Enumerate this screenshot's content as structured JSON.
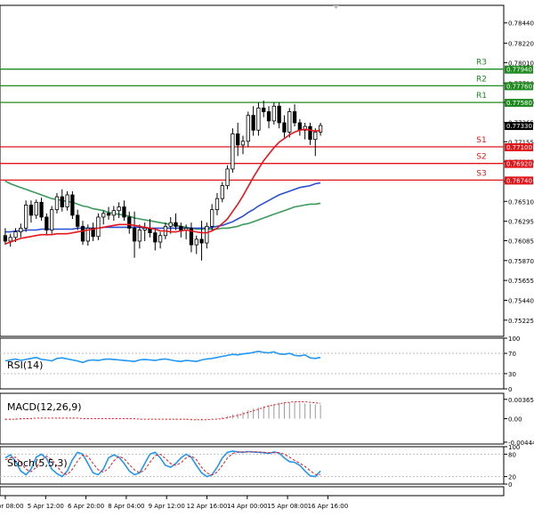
{
  "chart_data": {
    "type": "candlestick",
    "price": {
      "ylim": [
        0.7505,
        0.7863
      ],
      "yticks": [
        "0.78440",
        "0.78220",
        "0.78010",
        "0.77790",
        "0.77580",
        "0.77365",
        "0.77155",
        "0.76940",
        "0.76725",
        "0.76510",
        "0.76295",
        "0.76085",
        "0.75870",
        "0.75655",
        "0.75440",
        "0.75225"
      ],
      "current_price": "0.77330",
      "levels": [
        {
          "name": "R3",
          "value": 0.7794,
          "label": "0.77940",
          "color": "#1f8a1f"
        },
        {
          "name": "R2",
          "value": 0.7776,
          "label": "0.77760",
          "color": "#1f8a1f"
        },
        {
          "name": "R1",
          "value": 0.7758,
          "label": "0.77580",
          "color": "#1f8a1f"
        },
        {
          "name": "S1",
          "value": 0.771,
          "label": "0.77100",
          "color": "#e0161a"
        },
        {
          "name": "S2",
          "value": 0.7692,
          "label": "0.76920",
          "color": "#e0161a"
        },
        {
          "name": "S3",
          "value": 0.7674,
          "label": "0.76740",
          "color": "#e0161a"
        }
      ],
      "candles": [
        [
          0.7614,
          0.7622,
          0.7604,
          0.7608
        ],
        [
          0.7608,
          0.7616,
          0.7602,
          0.7612
        ],
        [
          0.7612,
          0.7622,
          0.7607,
          0.7618
        ],
        [
          0.7618,
          0.7627,
          0.7612,
          0.7622
        ],
        [
          0.7622,
          0.7652,
          0.7618,
          0.7647
        ],
        [
          0.7647,
          0.7652,
          0.7628,
          0.7636
        ],
        [
          0.7636,
          0.7653,
          0.7632,
          0.765
        ],
        [
          0.765,
          0.7655,
          0.763,
          0.7634
        ],
        [
          0.7634,
          0.7638,
          0.7614,
          0.762
        ],
        [
          0.762,
          0.7646,
          0.7616,
          0.7642
        ],
        [
          0.7642,
          0.766,
          0.7638,
          0.7656
        ],
        [
          0.7656,
          0.7664,
          0.764,
          0.7645
        ],
        [
          0.7645,
          0.7662,
          0.7641,
          0.7658
        ],
        [
          0.7658,
          0.7662,
          0.7632,
          0.7636
        ],
        [
          0.7636,
          0.7642,
          0.762,
          0.7624
        ],
        [
          0.7624,
          0.763,
          0.7604,
          0.7608
        ],
        [
          0.7608,
          0.7626,
          0.7603,
          0.7622
        ],
        [
          0.7622,
          0.7628,
          0.7608,
          0.7613
        ],
        [
          0.7613,
          0.7638,
          0.7609,
          0.7634
        ],
        [
          0.7634,
          0.7641,
          0.7626,
          0.7638
        ],
        [
          0.7638,
          0.7645,
          0.7631,
          0.7636
        ],
        [
          0.7636,
          0.7646,
          0.763,
          0.7641
        ],
        [
          0.7641,
          0.765,
          0.7633,
          0.7645
        ],
        [
          0.7645,
          0.7652,
          0.763,
          0.7634
        ],
        [
          0.7634,
          0.764,
          0.7616,
          0.7622
        ],
        [
          0.7622,
          0.764,
          0.759,
          0.7608
        ],
        [
          0.7608,
          0.7626,
          0.76,
          0.762
        ],
        [
          0.762,
          0.7628,
          0.7608,
          0.7622
        ],
        [
          0.7622,
          0.7632,
          0.7612,
          0.7617
        ],
        [
          0.7617,
          0.7622,
          0.7598,
          0.7607
        ],
        [
          0.7607,
          0.7618,
          0.76,
          0.7614
        ],
        [
          0.7614,
          0.7628,
          0.761,
          0.7624
        ],
        [
          0.7624,
          0.7634,
          0.7616,
          0.7628
        ],
        [
          0.7628,
          0.7638,
          0.762,
          0.7624
        ],
        [
          0.7624,
          0.7628,
          0.7612,
          0.762
        ],
        [
          0.762,
          0.7626,
          0.761,
          0.7622
        ],
        [
          0.7622,
          0.7628,
          0.7596,
          0.7604
        ],
        [
          0.7604,
          0.7614,
          0.7594,
          0.761
        ],
        [
          0.761,
          0.763,
          0.7587,
          0.7606
        ],
        [
          0.7606,
          0.7628,
          0.76,
          0.7624
        ],
        [
          0.7624,
          0.7648,
          0.762,
          0.7642
        ],
        [
          0.7642,
          0.766,
          0.7636,
          0.7654
        ],
        [
          0.7654,
          0.7672,
          0.765,
          0.7668
        ],
        [
          0.7668,
          0.769,
          0.7664,
          0.7686
        ],
        [
          0.7686,
          0.773,
          0.7682,
          0.7724
        ],
        [
          0.7724,
          0.7736,
          0.77,
          0.7712
        ],
        [
          0.7712,
          0.7722,
          0.7702,
          0.7716
        ],
        [
          0.7716,
          0.7748,
          0.771,
          0.7744
        ],
        [
          0.7744,
          0.7754,
          0.7722,
          0.7728
        ],
        [
          0.7728,
          0.7758,
          0.7722,
          0.7752
        ],
        [
          0.7752,
          0.776,
          0.7742,
          0.7748
        ],
        [
          0.7748,
          0.7754,
          0.773,
          0.7738
        ],
        [
          0.7738,
          0.7758,
          0.7734,
          0.7754
        ],
        [
          0.7754,
          0.7758,
          0.773,
          0.7736
        ],
        [
          0.7736,
          0.7744,
          0.772,
          0.7726
        ],
        [
          0.7726,
          0.7752,
          0.772,
          0.7748
        ],
        [
          0.7748,
          0.7756,
          0.7732,
          0.7736
        ],
        [
          0.7736,
          0.774,
          0.7722,
          0.7728
        ],
        [
          0.7728,
          0.7736,
          0.7718,
          0.7732
        ],
        [
          0.7732,
          0.7736,
          0.7712,
          0.7718
        ],
        [
          0.7718,
          0.773,
          0.77,
          0.7726
        ],
        [
          0.7726,
          0.7736,
          0.7722,
          0.7733
        ]
      ],
      "ma_fast": {
        "color": "#e8151b",
        "values": [
          0.7605,
          0.7607,
          0.7609,
          0.7611,
          0.7612,
          0.7613,
          0.7614,
          0.7615,
          0.7615,
          0.7615,
          0.7616,
          0.7616,
          0.7616,
          0.7617,
          0.7618,
          0.7619,
          0.762,
          0.7621,
          0.7622,
          0.7623,
          0.7624,
          0.7625,
          0.7626,
          0.7626,
          0.7626,
          0.7625,
          0.7624,
          0.7623,
          0.7622,
          0.7621,
          0.7619,
          0.7619,
          0.7618,
          0.7618,
          0.7619,
          0.762,
          0.7619,
          0.7618,
          0.7617,
          0.7617,
          0.7619,
          0.7622,
          0.7627,
          0.7632,
          0.764,
          0.7648,
          0.7657,
          0.7667,
          0.7677,
          0.7686,
          0.7695,
          0.7702,
          0.7709,
          0.7715,
          0.7719,
          0.7723,
          0.7726,
          0.7728,
          0.7729,
          0.7728,
          0.7727,
          0.7728
        ]
      },
      "ma_mid": {
        "color": "#2a4fd6",
        "values": [
          0.7618,
          0.7618,
          0.7619,
          0.7619,
          0.762,
          0.762,
          0.762,
          0.7621,
          0.7621,
          0.7621,
          0.7621,
          0.7621,
          0.7621,
          0.7621,
          0.7622,
          0.7622,
          0.7622,
          0.7622,
          0.7622,
          0.7623,
          0.7623,
          0.7623,
          0.7623,
          0.7623,
          0.7623,
          0.7623,
          0.7623,
          0.7622,
          0.7622,
          0.7622,
          0.7622,
          0.7622,
          0.7622,
          0.7622,
          0.7622,
          0.7622,
          0.7622,
          0.7622,
          0.7622,
          0.7622,
          0.7623,
          0.7624,
          0.7625,
          0.7627,
          0.7629,
          0.7632,
          0.7635,
          0.7639,
          0.7642,
          0.7646,
          0.7649,
          0.7652,
          0.7655,
          0.7658,
          0.766,
          0.7662,
          0.7664,
          0.7666,
          0.7667,
          0.7668,
          0.767,
          0.7671
        ]
      },
      "ma_slow": {
        "color": "#3a9a5a",
        "values": [
          0.7673,
          0.767,
          0.7668,
          0.7666,
          0.7664,
          0.7662,
          0.766,
          0.7658,
          0.7656,
          0.7654,
          0.7653,
          0.7652,
          0.7651,
          0.765,
          0.7648,
          0.7646,
          0.7645,
          0.7643,
          0.7642,
          0.7641,
          0.7639,
          0.7638,
          0.7637,
          0.7636,
          0.7635,
          0.7633,
          0.7632,
          0.7631,
          0.763,
          0.7629,
          0.7628,
          0.7627,
          0.7626,
          0.7625,
          0.7624,
          0.7623,
          0.7622,
          0.7621,
          0.7621,
          0.7621,
          0.7621,
          0.7621,
          0.7622,
          0.7622,
          0.7623,
          0.7624,
          0.7626,
          0.7627,
          0.7629,
          0.7631,
          0.7633,
          0.7635,
          0.7637,
          0.7639,
          0.7641,
          0.7643,
          0.7645,
          0.7646,
          0.7647,
          0.7648,
          0.7648,
          0.7649
        ]
      }
    },
    "x_tick_labels": [
      "2 Apr 08:00",
      "5 Apr 12:00",
      "6 Apr 20:00",
      "8 Apr 04:00",
      "9 Apr 12:00",
      "12 Apr 16:00",
      "14 Apr 00:00",
      "15 Apr 08:00",
      "16 Apr 16:00"
    ],
    "rsi": {
      "label": "RSI(14)",
      "ylim": [
        0,
        100
      ],
      "yticks": [
        "100",
        "70",
        "30",
        "0"
      ],
      "color": "#2196f3",
      "values": [
        55,
        57,
        59,
        56,
        58,
        60,
        62,
        58,
        57,
        55,
        60,
        61,
        59,
        57,
        55,
        52,
        56,
        57,
        56,
        58,
        59,
        58,
        57,
        56,
        55,
        54,
        57,
        58,
        57,
        56,
        58,
        59,
        57,
        55,
        54,
        56,
        55,
        54,
        57,
        59,
        60,
        62,
        64,
        66,
        68,
        67,
        69,
        70,
        72,
        74,
        72,
        71,
        73,
        69,
        68,
        70,
        66,
        65,
        67,
        61,
        60,
        62
      ]
    },
    "macd": {
      "label": "MACD(12,26,9)",
      "yticks": [
        "0.003659",
        "0.00",
        "-0.004448"
      ],
      "ylim": [
        -0.0048,
        0.0048
      ],
      "histogram": [
        -0.0003,
        -0.0003,
        -0.0002,
        -0.0002,
        -0.0001,
        -0.0001,
        0.0,
        0.0,
        0.0,
        0.0001,
        0.0001,
        0.0001,
        0.0001,
        0.0001,
        0.0,
        0.0,
        0.0,
        0.0,
        0.0,
        0.0,
        0.0,
        0.0,
        0.0,
        0.0,
        0.0,
        -0.0001,
        -0.0001,
        -0.0001,
        -0.0001,
        -0.0001,
        -0.0001,
        -0.0001,
        -0.0002,
        -0.0002,
        -0.0002,
        -0.0002,
        -0.0002,
        -0.0002,
        -0.0002,
        -0.0001,
        0.0,
        0.0001,
        0.0003,
        0.0005,
        0.0008,
        0.001,
        0.0013,
        0.0016,
        0.0019,
        0.0021,
        0.0024,
        0.0026,
        0.0028,
        0.003,
        0.0031,
        0.0031,
        0.0031,
        0.003,
        0.0029,
        0.0028,
        0.0027,
        0.0026
      ],
      "signal": [
        -0.0001,
        -0.0001,
        -0.0001,
        0.0,
        0.0,
        0.0,
        0.0001,
        0.0001,
        0.0001,
        0.0001,
        0.0001,
        0.0001,
        0.0001,
        0.0001,
        0.0001,
        0.0,
        0.0,
        0.0,
        0.0,
        0.0,
        0.0,
        0.0,
        0.0,
        0.0,
        0.0,
        0.0,
        -0.0001,
        -0.0001,
        -0.0001,
        -0.0001,
        -0.0001,
        -0.0001,
        -0.0001,
        -0.0001,
        -0.0001,
        -0.0001,
        -0.0002,
        -0.0002,
        -0.0002,
        -0.0002,
        -0.0001,
        -0.0001,
        0.0,
        0.0002,
        0.0004,
        0.0006,
        0.0009,
        0.0012,
        0.0015,
        0.0018,
        0.0021,
        0.0024,
        0.0026,
        0.0028,
        0.003,
        0.0031,
        0.0032,
        0.0032,
        0.0032,
        0.0031,
        0.003,
        0.0029
      ]
    },
    "stoch": {
      "label": "Stoch(5,5,3)",
      "ylim": [
        0,
        100
      ],
      "yticks": [
        "100",
        "80",
        "20",
        "0"
      ],
      "main_color": "#2196f3",
      "signal_color": "#e8151b",
      "main": [
        70,
        78,
        60,
        35,
        25,
        40,
        72,
        80,
        68,
        40,
        28,
        20,
        35,
        65,
        85,
        80,
        55,
        30,
        25,
        40,
        70,
        78,
        72,
        55,
        35,
        25,
        30,
        55,
        80,
        85,
        70,
        50,
        45,
        55,
        70,
        80,
        72,
        50,
        30,
        20,
        25,
        45,
        70,
        85,
        88,
        86,
        85,
        87,
        86,
        85,
        84,
        82,
        86,
        83,
        70,
        60,
        58,
        50,
        35,
        22,
        20,
        35
      ],
      "signal": [
        65,
        70,
        72,
        58,
        40,
        33,
        45,
        64,
        75,
        65,
        48,
        30,
        25,
        40,
        62,
        78,
        74,
        55,
        38,
        32,
        42,
        62,
        74,
        68,
        52,
        38,
        30,
        38,
        58,
        76,
        80,
        68,
        55,
        50,
        57,
        70,
        76,
        65,
        45,
        30,
        24,
        32,
        50,
        70,
        82,
        86,
        86,
        86,
        86,
        86,
        85,
        84,
        84,
        84,
        80,
        72,
        63,
        56,
        47,
        36,
        26,
        25
      ]
    }
  }
}
